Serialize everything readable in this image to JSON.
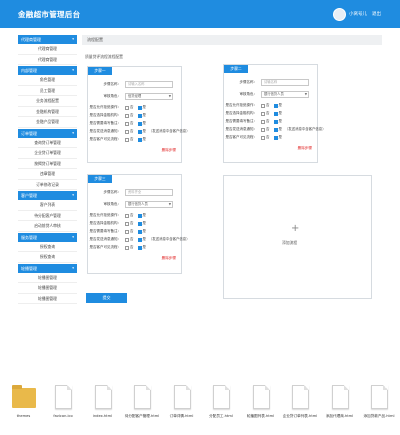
{
  "header": {
    "title": "金融超市管理后台",
    "username": "小窝号儿",
    "logout": "退出"
  },
  "sidebar": [
    {
      "label": "代理商管理",
      "items": [
        "代理商管理",
        "代理商管理"
      ]
    },
    {
      "label": "内部管理",
      "items": [
        "角色管理",
        "员工管理",
        "业务流程配置",
        "金融机构管理",
        "金融产品管理"
      ]
    },
    {
      "label": "订单管理",
      "items": [
        "查询贷订单管理",
        "企业贷订单管理",
        "按揭贷订单管理",
        "违章管理",
        "订单修改记录"
      ]
    },
    {
      "label": "客户管理",
      "items": [
        "客户列表",
        "待分配客户管理",
        "启动前贷人审核"
      ]
    },
    {
      "label": "服务管理",
      "items": [
        "授权查询",
        "授权查询"
      ]
    },
    {
      "label": "轮播管理",
      "items": [
        "轮播图管理",
        "轮播图管理",
        "轮播图管理"
      ]
    }
  ],
  "content": {
    "breadcrumb": "流程配置",
    "note": "质量贷评流程流程配置",
    "submit": "提交",
    "add_label": "添加流程",
    "delete_label": "删除步骤",
    "labels": {
      "name": "步骤名称：",
      "role": "审核角色：",
      "q1": "是否允许拒绝操作：",
      "q2": "是否选择金融机构：",
      "q3": "是否需要填写备注：",
      "q4": "是否发送消息通知：",
      "q5": "是否客户可见流程："
    },
    "opt_no": "否",
    "opt_yes": "是",
    "msg_note": "（发送消息中含客户信息）",
    "steps": [
      {
        "tag": "步骤一",
        "name_placeholder": "请输入名称",
        "role": "信贷经理"
      },
      {
        "tag": "步骤二",
        "name_placeholder": "请输名称",
        "role": "银行信贷人员"
      },
      {
        "tag": "步骤三",
        "name_placeholder": "资料齐全",
        "role": "银行信贷人员"
      }
    ]
  },
  "files": [
    "themes",
    "favicon.ico",
    "index.html",
    "待分配客户管理.html",
    "订单详情.html",
    "分配员工.html",
    "轮播图列表.html",
    "企业贷订单列表.html",
    "添加代理商.html",
    "添加贷款产品.html"
  ]
}
